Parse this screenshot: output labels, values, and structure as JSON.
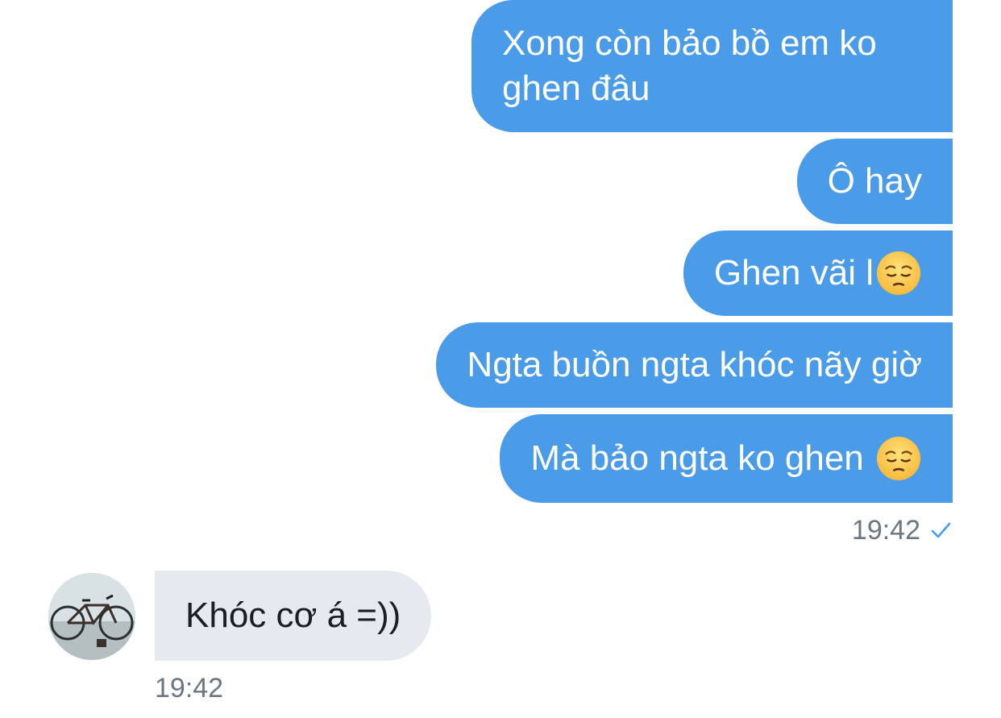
{
  "conversation": {
    "outgoing": [
      {
        "text": "Xong còn bảo bồ em ko ghen đâu",
        "emoji": null
      },
      {
        "text": "Ô hay",
        "emoji": null
      },
      {
        "text": "Ghen vãi l",
        "emoji": "pensive-face"
      },
      {
        "text": "Ngta buồn ngta khóc nãy giờ",
        "emoji": null
      },
      {
        "text": "Mà bảo ngta ko ghen ",
        "emoji": "pensive-face"
      }
    ],
    "outgoing_time": "19:42",
    "outgoing_status_icon": "checkmark-icon",
    "incoming": [
      {
        "text": "Khóc cơ á =))"
      }
    ],
    "incoming_time": "19:42"
  },
  "colors": {
    "outgoing_bubble": "#4a9be8",
    "incoming_bubble": "#e6e9f0",
    "timestamp": "#6b7680",
    "check": "#4a9be8"
  }
}
